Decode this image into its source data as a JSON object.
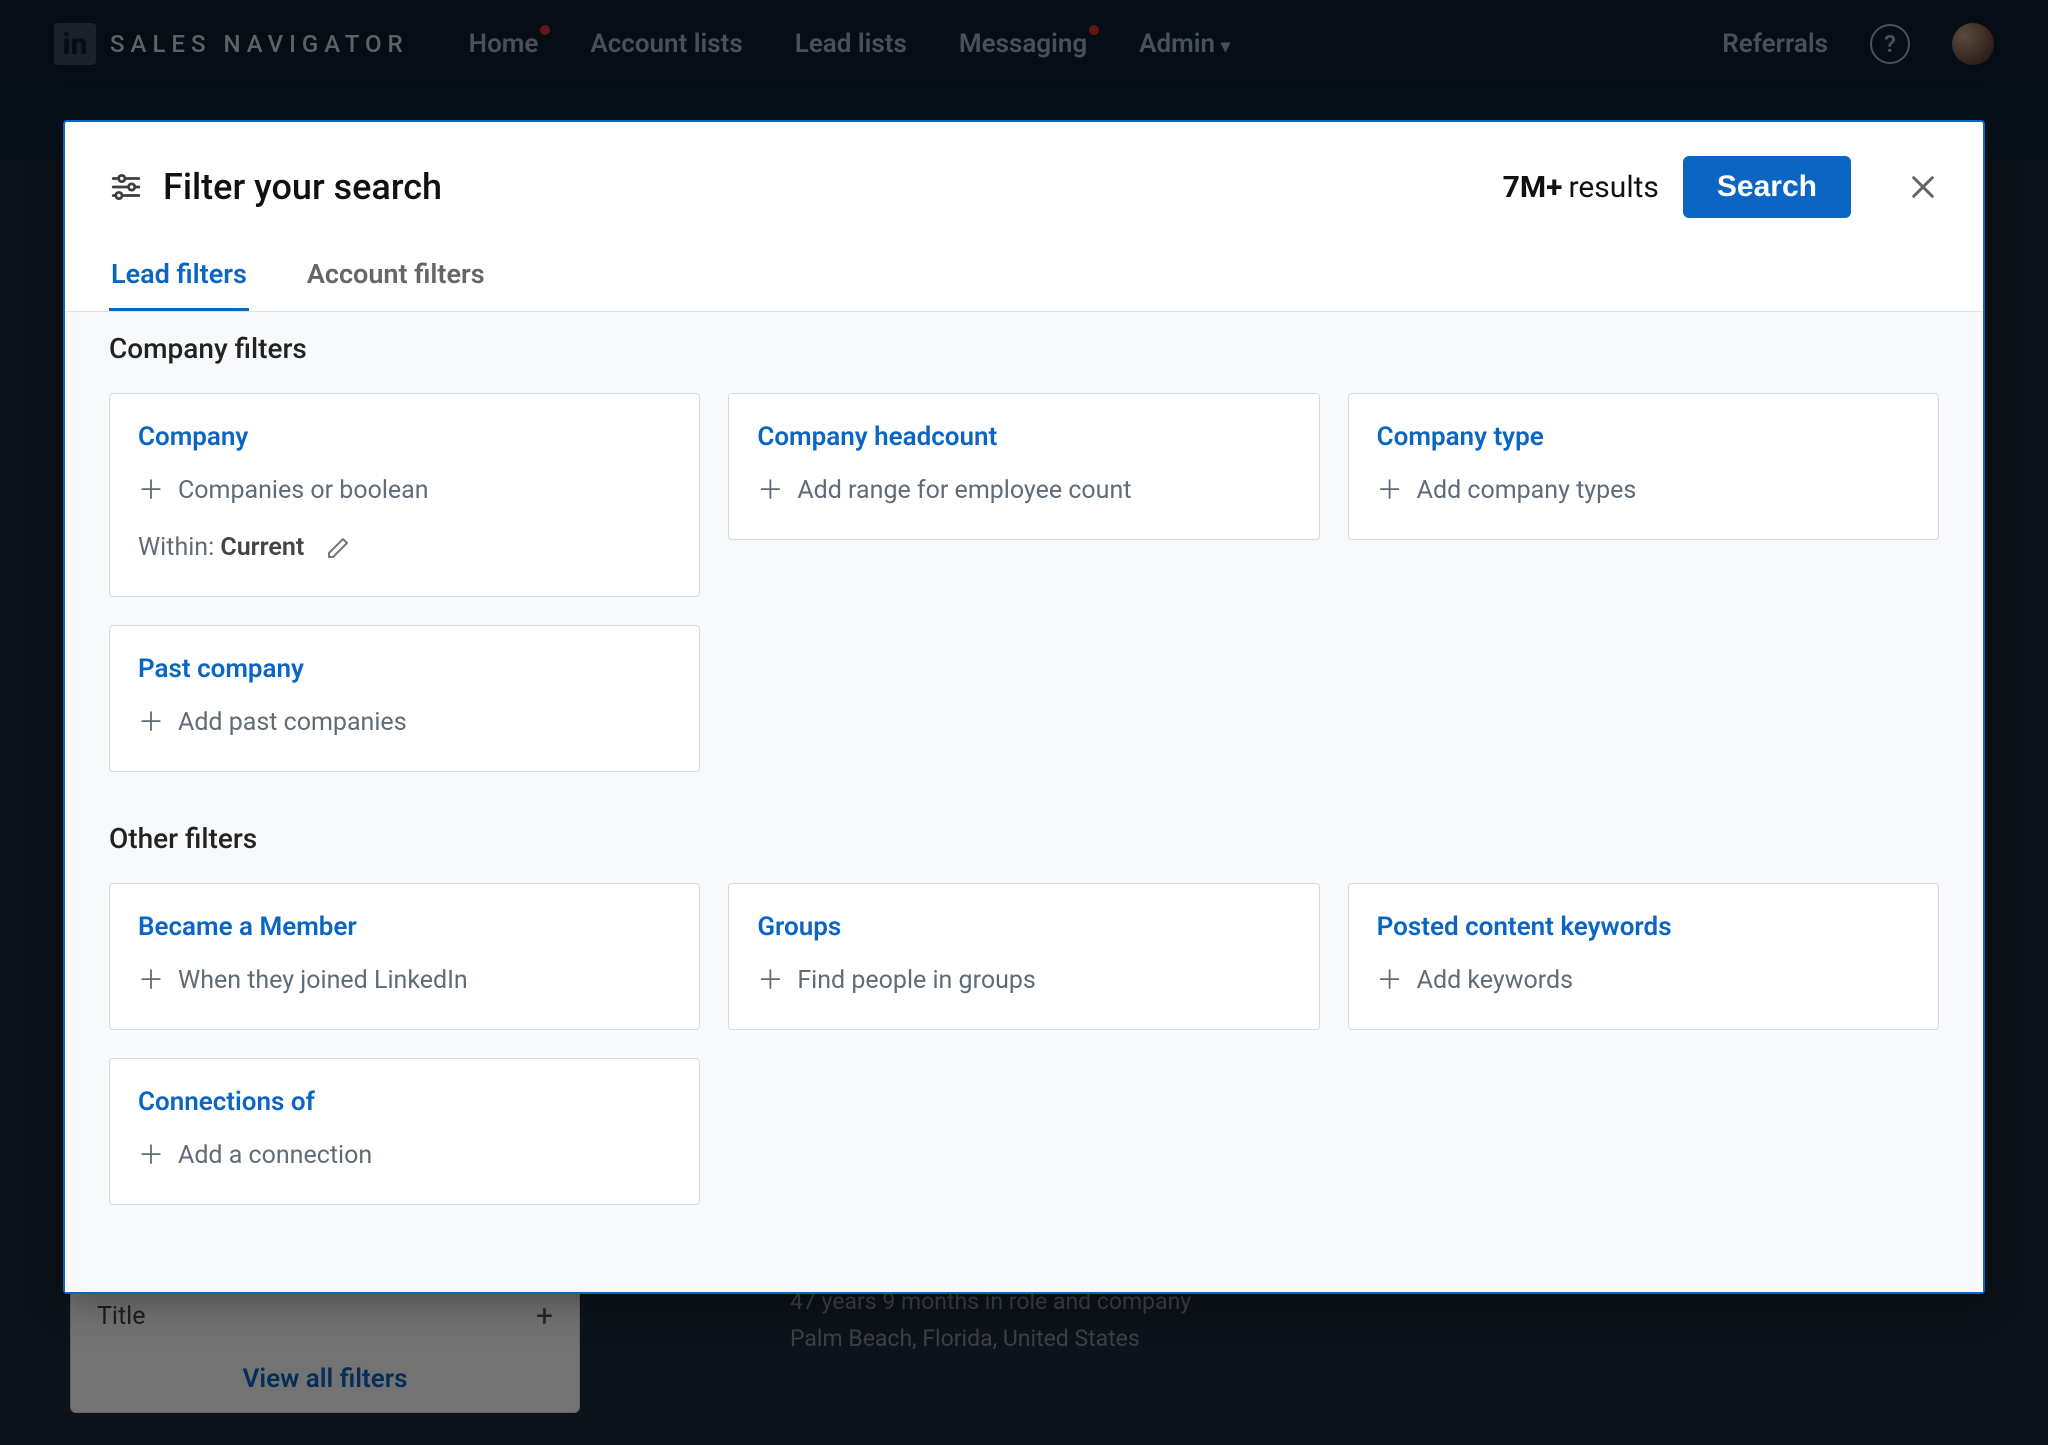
{
  "nav": {
    "brand": "SALES NAVIGATOR",
    "links": {
      "home": "Home",
      "account_lists": "Account lists",
      "lead_lists": "Lead lists",
      "messaging": "Messaging",
      "admin": "Admin"
    },
    "referrals": "Referrals"
  },
  "modal": {
    "title": "Filter your search",
    "result_count_prefix": "7M+",
    "result_count_suffix": "results",
    "search_btn": "Search",
    "tabs": {
      "lead": "Lead filters",
      "account": "Account filters"
    },
    "sections": {
      "company": "Company filters",
      "other": "Other filters"
    },
    "cards": {
      "company": {
        "title": "Company",
        "hint": "Companies or boolean",
        "within_label": "Within:",
        "within_value": "Current"
      },
      "headcount": {
        "title": "Company headcount",
        "hint": "Add range for employee count"
      },
      "type": {
        "title": "Company type",
        "hint": "Add company types"
      },
      "past_company": {
        "title": "Past company",
        "hint": "Add past companies"
      },
      "became_member": {
        "title": "Became a Member",
        "hint": "When they joined LinkedIn"
      },
      "groups": {
        "title": "Groups",
        "hint": "Find people in groups"
      },
      "posted_keywords": {
        "title": "Posted content keywords",
        "hint": "Add keywords"
      },
      "connections_of": {
        "title": "Connections of",
        "hint": "Add a connection"
      }
    }
  },
  "behind": {
    "title_row": "Title",
    "view_all": "View all filters",
    "result_line1": "47 years 9 months in role and company",
    "result_line2": "Palm Beach, Florida, United States"
  }
}
